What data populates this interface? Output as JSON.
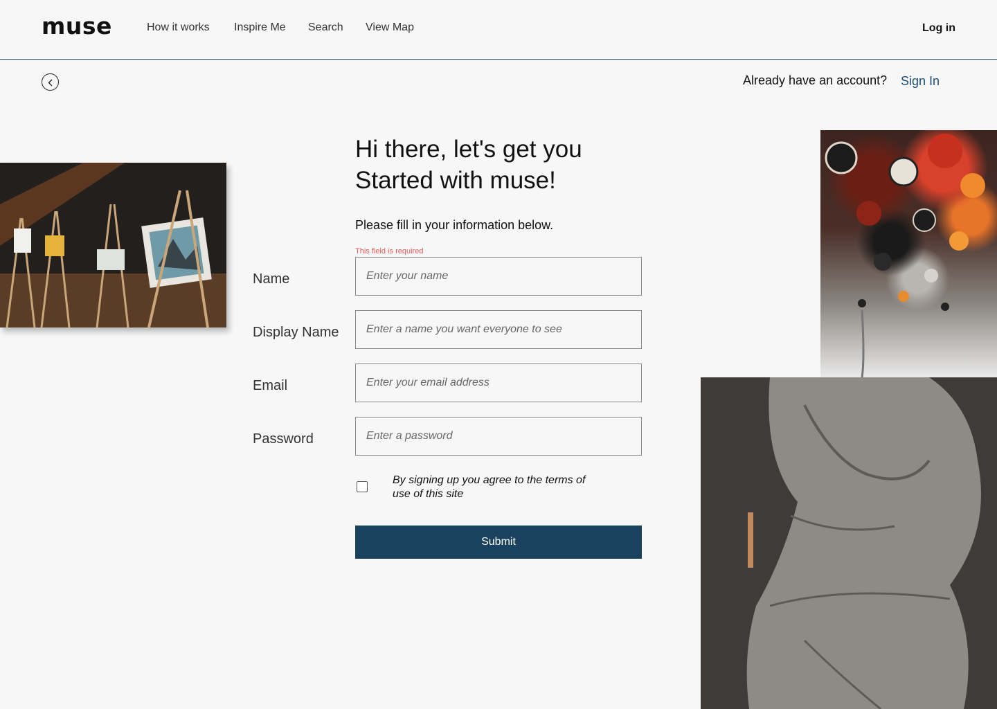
{
  "header": {
    "logo": "muse",
    "nav": [
      "How it works",
      "Inspire Me",
      "Search",
      "View Map"
    ],
    "login": "Log in"
  },
  "account": {
    "prompt": "Already have an account?",
    "signin": "Sign In"
  },
  "form": {
    "heading_line1": "Hi there, let's get you",
    "heading_line2": "Started with muse!",
    "subheading": "Please fill in your information below.",
    "error": "This field is required",
    "fields": [
      {
        "label": "Name",
        "placeholder": "Enter your name"
      },
      {
        "label": "Display Name",
        "placeholder": "Enter a name you want everyone to see"
      },
      {
        "label": "Email",
        "placeholder": "Enter your email address"
      },
      {
        "label": "Password",
        "placeholder": "Enter a password"
      }
    ],
    "terms": "By signing up you agree to the terms of use of this site",
    "submit": "Submit"
  },
  "colors": {
    "accent": "#1a425e",
    "link": "#1e4d72",
    "error": "#e05a5a"
  },
  "icons": {
    "back": "chevron-left-circle-icon"
  }
}
